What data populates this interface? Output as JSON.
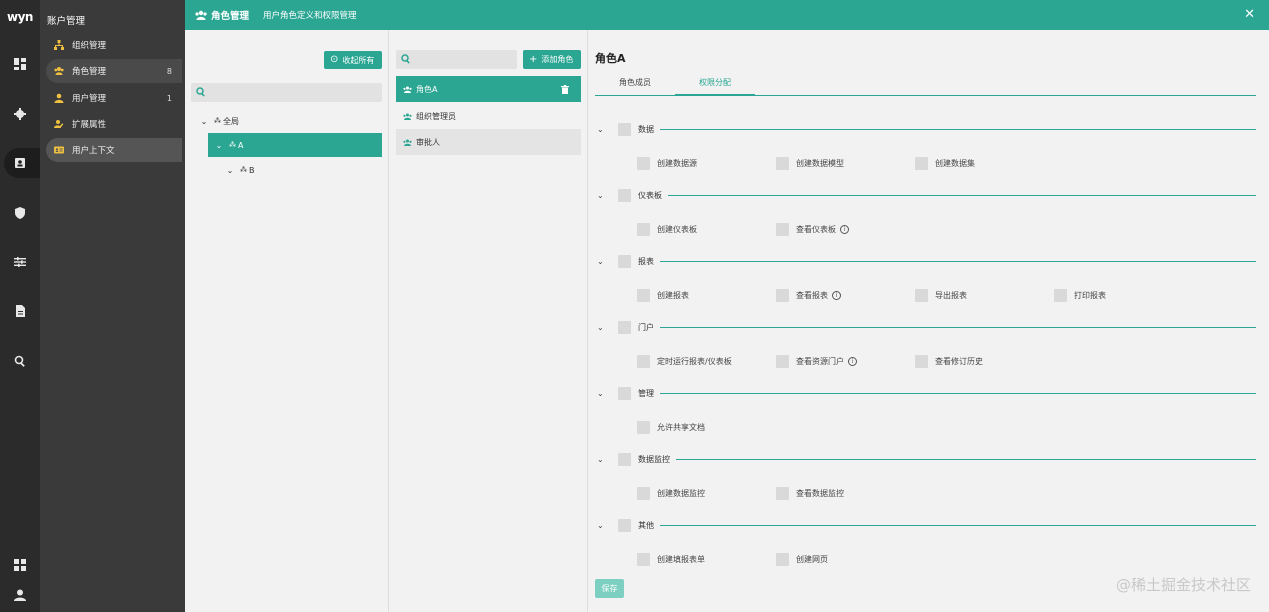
{
  "rail": {
    "logo": "wyn",
    "icons": [
      "dashboard-icon",
      "gear-icon",
      "contacts-icon",
      "shield-icon",
      "sliders-icon",
      "document-icon",
      "search-icon",
      "grid-icon",
      "user-icon"
    ]
  },
  "nav": {
    "title": "账户管理",
    "items": [
      {
        "label": "组织管理",
        "count": ""
      },
      {
        "label": "角色管理",
        "count": "8"
      },
      {
        "label": "用户管理",
        "count": "1"
      },
      {
        "label": "扩展属性",
        "count": ""
      },
      {
        "label": "用户上下文",
        "count": ""
      }
    ]
  },
  "header": {
    "title": "角色管理",
    "subtitle": "用户角色定义和权限管理",
    "close": "✕"
  },
  "org": {
    "collapse_all": "收起所有",
    "search_placeholder": "",
    "tree": [
      {
        "label": "全局",
        "chevron": "⌄"
      },
      {
        "label": "A",
        "chevron": "⌄"
      },
      {
        "label": "B",
        "chevron": "⌄"
      }
    ]
  },
  "roles": {
    "search_placeholder": "",
    "add_label": "添加角色",
    "items": [
      {
        "label": "角色A"
      },
      {
        "label": "组织管理员"
      },
      {
        "label": "审批人"
      }
    ]
  },
  "detail": {
    "title": "角色A",
    "tabs": [
      "角色成员",
      "权限分配"
    ],
    "sections": [
      {
        "label": "数据",
        "perms": [
          {
            "label": "创建数据源"
          },
          {
            "label": "创建数据模型"
          },
          {
            "label": "创建数据集"
          }
        ]
      },
      {
        "label": "仪表板",
        "perms": [
          {
            "label": "创建仪表板"
          },
          {
            "label": "查看仪表板",
            "info": true
          }
        ]
      },
      {
        "label": "报表",
        "perms": [
          {
            "label": "创建报表"
          },
          {
            "label": "查看报表",
            "info": true
          },
          {
            "label": "导出报表"
          },
          {
            "label": "打印报表"
          }
        ]
      },
      {
        "label": "门户",
        "perms": [
          {
            "label": "定时运行报表/仪表板"
          },
          {
            "label": "查看资源门户",
            "info": true
          },
          {
            "label": "查看修订历史"
          }
        ]
      },
      {
        "label": "管理",
        "perms": [
          {
            "label": "允许共享文档"
          }
        ]
      },
      {
        "label": "数据监控",
        "perms": [
          {
            "label": "创建数据监控"
          },
          {
            "label": "查看数据监控"
          }
        ]
      },
      {
        "label": "其他",
        "perms": [
          {
            "label": "创建填报表单"
          },
          {
            "label": "创建网页"
          }
        ]
      }
    ],
    "save_label": "保存"
  },
  "watermark": "@稀土掘金技术社区",
  "colors": {
    "accent": "#2aa693",
    "rail": "#2b2b2b",
    "nav": "#3a3a3a"
  }
}
